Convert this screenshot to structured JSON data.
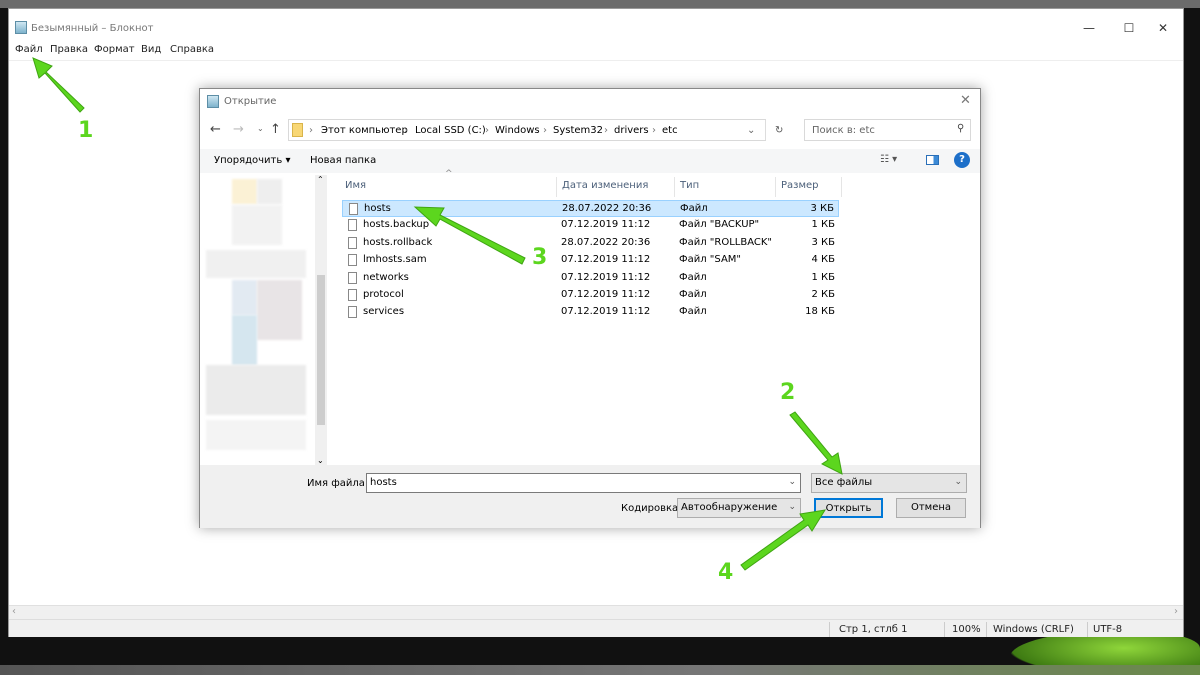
{
  "notepad": {
    "title": "Безымянный – Блокнот",
    "menu": [
      "Файл",
      "Правка",
      "Формат",
      "Вид",
      "Справка"
    ],
    "status": {
      "position": "Стр 1, стлб 1",
      "zoom": "100%",
      "line_ending": "Windows (CRLF)",
      "encoding": "UTF-8"
    }
  },
  "dialog": {
    "title": "Открытие",
    "breadcrumb": [
      "Этот компьютер",
      "Local SSD (C:)",
      "Windows",
      "System32",
      "drivers",
      "etc"
    ],
    "search_placeholder": "Поиск в: etc",
    "toolbar": {
      "organize": "Упорядочить",
      "new_folder": "Новая папка"
    },
    "columns": [
      "Имя",
      "Дата изменения",
      "Тип",
      "Размер"
    ],
    "files": [
      {
        "name": "hosts",
        "date": "28.07.2022 20:36",
        "type": "Файл",
        "size": "3 КБ",
        "selected": true
      },
      {
        "name": "hosts.backup",
        "date": "07.12.2019 11:12",
        "type": "Файл \"BACKUP\"",
        "size": "1 КБ"
      },
      {
        "name": "hosts.rollback",
        "date": "28.07.2022 20:36",
        "type": "Файл \"ROLLBACK\"",
        "size": "3 КБ"
      },
      {
        "name": "lmhosts.sam",
        "date": "07.12.2019 11:12",
        "type": "Файл \"SAM\"",
        "size": "4 КБ"
      },
      {
        "name": "networks",
        "date": "07.12.2019 11:12",
        "type": "Файл",
        "size": "1 КБ"
      },
      {
        "name": "protocol",
        "date": "07.12.2019 11:12",
        "type": "Файл",
        "size": "2 КБ"
      },
      {
        "name": "services",
        "date": "07.12.2019 11:12",
        "type": "Файл",
        "size": "18 КБ"
      }
    ],
    "filename_label": "Имя файла:",
    "filename_value": "hosts",
    "filetype": "Все файлы",
    "encoding_label": "Кодировка:",
    "encoding_value": "Автообнаружение",
    "open": "Открыть",
    "cancel": "Отмена"
  },
  "annotations": [
    "1",
    "2",
    "3",
    "4"
  ],
  "colors": {
    "arrow": "#5cd61e",
    "selection": "#cce8ff"
  }
}
